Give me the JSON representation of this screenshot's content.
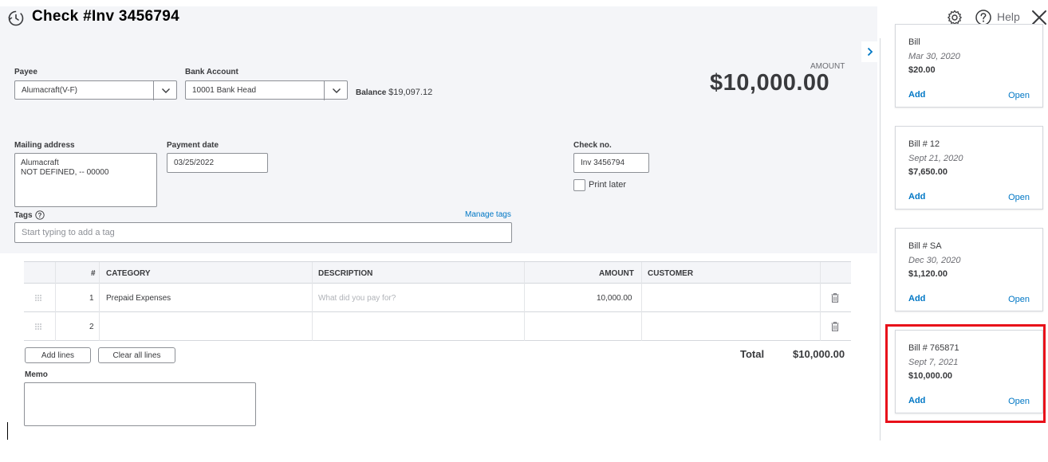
{
  "header": {
    "title": "Check #Inv 3456794",
    "help_label": "Help"
  },
  "form": {
    "payee": {
      "label": "Payee",
      "value": "Alumacraft(V-F)"
    },
    "bank_account": {
      "label": "Bank Account",
      "value": "10001 Bank Head"
    },
    "balance": {
      "label": "Balance",
      "value": "$19,097.12"
    },
    "amount": {
      "label": "AMOUNT",
      "value": "$10,000.00"
    },
    "mailing_address": {
      "label": "Mailing address",
      "line1": "Alumacraft",
      "line2": "NOT DEFINED, --  00000"
    },
    "payment_date": {
      "label": "Payment date",
      "value": "03/25/2022"
    },
    "check_no": {
      "label": "Check no.",
      "value": "Inv 3456794"
    },
    "print_later": {
      "label": "Print later",
      "checked": false
    },
    "tags": {
      "label": "Tags",
      "placeholder": "Start typing to add a tag",
      "manage_label": "Manage tags"
    },
    "memo": {
      "label": "Memo"
    }
  },
  "table": {
    "headers": {
      "num": "#",
      "category": "CATEGORY",
      "description": "DESCRIPTION",
      "amount": "AMOUNT",
      "customer": "CUSTOMER"
    },
    "rows": [
      {
        "num": "1",
        "category": "Prepaid Expenses",
        "description": "What did you pay for?",
        "amount": "10,000.00",
        "customer": ""
      },
      {
        "num": "2",
        "category": "",
        "description": "",
        "amount": "",
        "customer": ""
      }
    ],
    "add_lines_label": "Add lines",
    "clear_lines_label": "Clear all lines",
    "total_label": "Total",
    "total_value": "$10,000.00"
  },
  "side_panel": {
    "cards": [
      {
        "title": "Bill",
        "date": "Mar 30, 2020",
        "amount": "$20.00",
        "add_label": "Add",
        "open_label": "Open"
      },
      {
        "title": "Bill # 12",
        "date": "Sept 21, 2020",
        "amount": "$7,650.00",
        "add_label": "Add",
        "open_label": "Open"
      },
      {
        "title": "Bill # SA",
        "date": "Dec 30, 2020",
        "amount": "$1,120.00",
        "add_label": "Add",
        "open_label": "Open"
      },
      {
        "title": "Bill # 765871",
        "date": "Sept 7, 2021",
        "amount": "$10,000.00",
        "add_label": "Add",
        "open_label": "Open",
        "highlighted": true
      }
    ]
  },
  "colors": {
    "link": "#0077c5",
    "highlight": "#e8101a",
    "band": "#f4f5f8"
  }
}
